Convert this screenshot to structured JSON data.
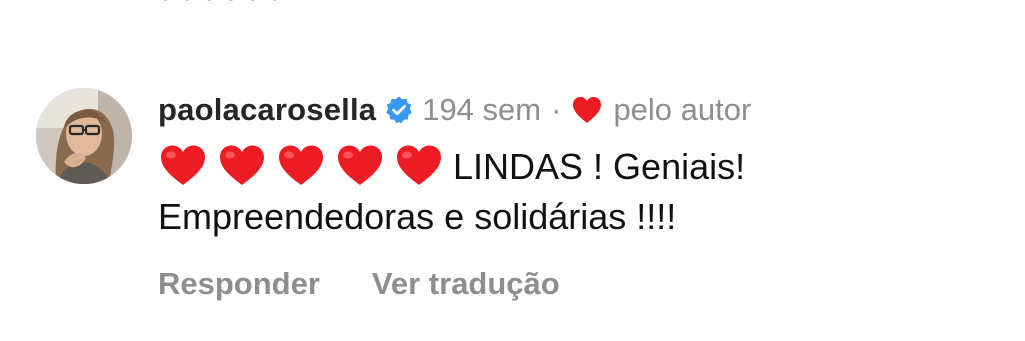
{
  "previous_comment": {
    "remnant": "  ·        ·        ·        ·        ·        ·"
  },
  "comment": {
    "username": "paolacarosella",
    "verified_icon": "verified-badge-icon",
    "timestamp": "194 sem",
    "separator": "·",
    "liked_by_author_icon": "heart-icon",
    "liked_by_author_label": "pelo autor",
    "emoji": [
      "❤️",
      "❤️",
      "❤️",
      "❤️",
      "❤️"
    ],
    "text_line1": "LINDAS ! Geniais!",
    "text_line2": "Empreendedoras e solidárias !!!!",
    "colors": {
      "heart_red": "#ed1c24",
      "verified_blue": "#3897f0",
      "muted_gray": "#8e8e8e",
      "text_dark": "#262626"
    }
  },
  "actions": {
    "reply": "Responder",
    "translate": "Ver tradução"
  }
}
